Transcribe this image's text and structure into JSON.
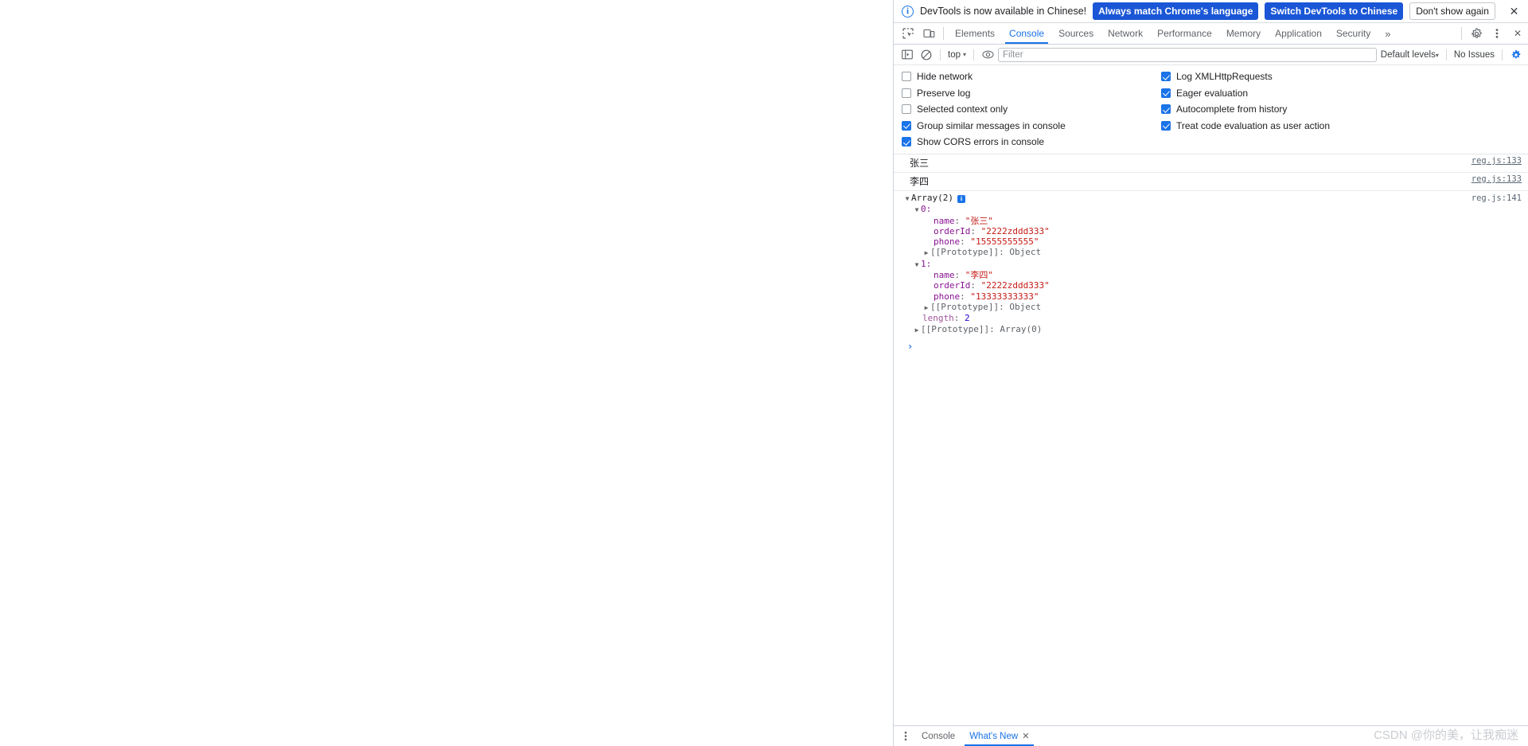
{
  "infobar": {
    "icon": "info-circle-icon",
    "message": "DevTools is now available in Chinese!",
    "primary_button": "Always match Chrome's language",
    "secondary_button": "Switch DevTools to Chinese",
    "dismiss_button": "Don't show again",
    "close_icon": "✕"
  },
  "tabbar": {
    "inspect_icon": "inspect-element-icon",
    "device_icon": "device-toolbar-icon",
    "tabs": [
      {
        "label": "Elements",
        "active": false
      },
      {
        "label": "Console",
        "active": true
      },
      {
        "label": "Sources",
        "active": false
      },
      {
        "label": "Network",
        "active": false
      },
      {
        "label": "Performance",
        "active": false
      },
      {
        "label": "Memory",
        "active": false
      },
      {
        "label": "Application",
        "active": false
      },
      {
        "label": "Security",
        "active": false
      }
    ],
    "more_tabs": "»",
    "settings_icon": "gear-icon",
    "menu_icon": "kebab-menu-icon",
    "close_icon": "✕"
  },
  "console_toolbar": {
    "sidebar_icon": "console-sidebar-icon",
    "clear_icon": "clear-console-icon",
    "context": "top",
    "context_caret": "▾",
    "live_expression_icon": "eye-icon",
    "filter_placeholder": "Filter",
    "filter_value": "",
    "levels": "Default levels",
    "levels_caret": "▾",
    "issues": "No Issues",
    "settings_icon": "gear-icon"
  },
  "settings": {
    "left_column": [
      {
        "label": "Hide network",
        "checked": false
      },
      {
        "label": "Preserve log",
        "checked": false
      },
      {
        "label": "Selected context only",
        "checked": false
      },
      {
        "label": "Group similar messages in console",
        "checked": true
      },
      {
        "label": "Show CORS errors in console",
        "checked": true
      }
    ],
    "right_column": [
      {
        "label": "Log XMLHttpRequests",
        "checked": true
      },
      {
        "label": "Eager evaluation",
        "checked": true
      },
      {
        "label": "Autocomplete from history",
        "checked": true
      },
      {
        "label": "Treat code evaluation as user action",
        "checked": true
      }
    ]
  },
  "console_messages": [
    {
      "text": "张三",
      "source": "reg.js:133"
    },
    {
      "text": "李四",
      "source": "reg.js:133"
    }
  ],
  "array_log": {
    "source": "reg.js:141",
    "header": "Array(2)",
    "info_badge": "i",
    "arrow_open": "▼",
    "arrow_closed": "▶",
    "items": [
      {
        "index": "0:",
        "props": [
          {
            "key": "name",
            "value": "\"张三\""
          },
          {
            "key": "orderId",
            "value": "\"2222zddd333\""
          },
          {
            "key": "phone",
            "value": "\"15555555555\""
          }
        ],
        "prototype": "[[Prototype]]: Object"
      },
      {
        "index": "1:",
        "props": [
          {
            "key": "name",
            "value": "\"李四\""
          },
          {
            "key": "orderId",
            "value": "\"2222zddd333\""
          },
          {
            "key": "phone",
            "value": "\"13333333333\""
          }
        ],
        "prototype": "[[Prototype]]: Object"
      }
    ],
    "length_key": "length",
    "length_value": "2",
    "array_prototype": "[[Prototype]]: Array(0)"
  },
  "prompt": {
    "caret": "›",
    "value": ""
  },
  "drawer": {
    "menu_icon": "kebab-menu-icon",
    "tabs": [
      {
        "label": "Console",
        "active": false,
        "closable": false
      },
      {
        "label": "What's New",
        "active": true,
        "closable": true
      }
    ],
    "close_icon": "✕"
  },
  "watermark": "CSDN @你的美，让我痴迷",
  "colors": {
    "accent": "#1a73e8",
    "button_blue": "#1a56d6",
    "string_red": "#c41a16",
    "property_purple": "#881391",
    "number_blue": "#1c00cf"
  }
}
